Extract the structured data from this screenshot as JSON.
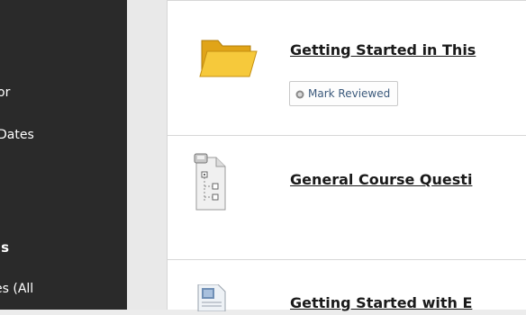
{
  "sidebar": {
    "items": [
      {
        "label": "or"
      },
      {
        "label": "Dates"
      },
      {
        "label": "s"
      }
    ],
    "heading": "ls",
    "truncated_item": "es (All"
  },
  "content": {
    "items": [
      {
        "title": "Getting Started in This",
        "icon": "folder-icon"
      },
      {
        "title": "General Course Questi",
        "icon": "discussion-board-icon"
      },
      {
        "title": "Getting Started with E",
        "icon": "document-icon"
      }
    ],
    "mark_reviewed_label": "Mark Reviewed"
  },
  "colors": {
    "sidebar_bg": "#2a2a2a",
    "folder": "#f5c232",
    "link_blue": "#3c5a7c"
  }
}
